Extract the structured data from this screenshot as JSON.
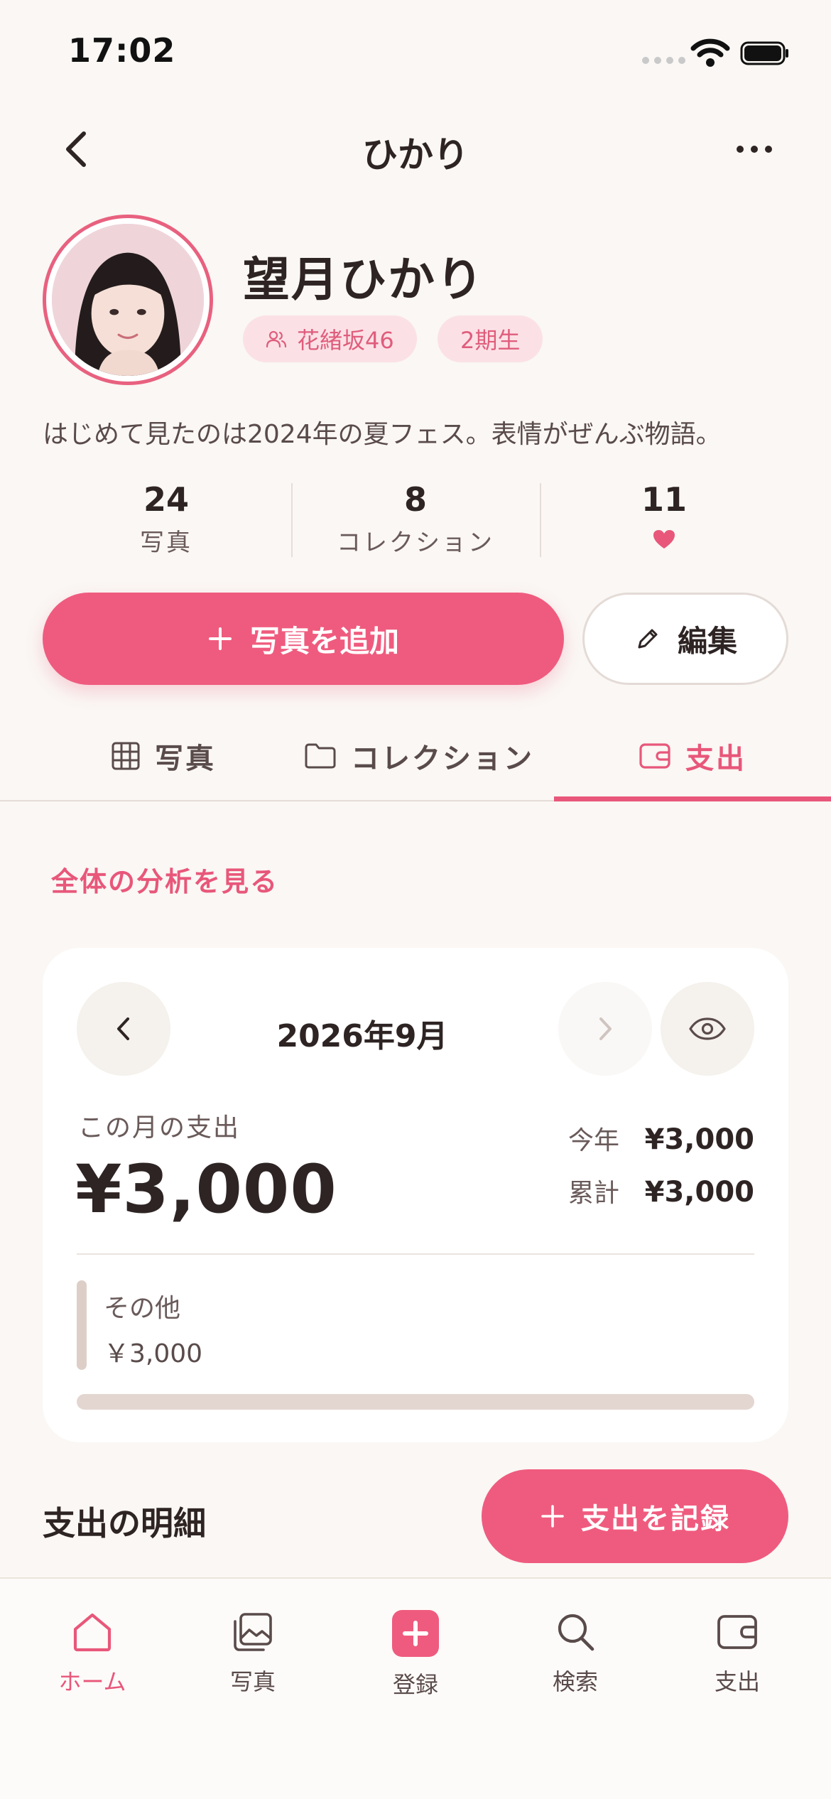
{
  "status_bar": {
    "time": "17:02"
  },
  "header": {
    "title": "ひかり"
  },
  "profile": {
    "name": "望月ひかり",
    "group_tag": "花緒坂46",
    "generation_tag": "2期生",
    "bio": "はじめて見たのは2024年の夏フェス。表情がぜんぶ物語。"
  },
  "stats": [
    {
      "value": "24",
      "label": "写真"
    },
    {
      "value": "8",
      "label": "コレクション"
    },
    {
      "value": "11",
      "label": "heart-icon"
    }
  ],
  "actions": {
    "add_photo": "写真を追加",
    "edit": "編集"
  },
  "tabs": [
    {
      "label": "写真",
      "icon": "grid-icon"
    },
    {
      "label": "コレクション",
      "icon": "folder-icon"
    },
    {
      "label": "支出",
      "icon": "wallet-icon",
      "active": true
    }
  ],
  "analysis_link": "全体の分析を見る",
  "month_card": {
    "month": "2026年9月",
    "month_label": "この月の支出",
    "month_total": "¥3,000",
    "year_label": "今年",
    "year_total": "¥3,000",
    "cumulative_label": "累計",
    "cumulative_total": "¥3,000",
    "category": {
      "name": "その他",
      "amount": "￥3,000",
      "share": 1.0
    }
  },
  "details": {
    "title": "支出の明細",
    "record_button": "支出を記録"
  },
  "bottom_nav": [
    {
      "label": "ホーム",
      "icon": "home-icon",
      "active": true
    },
    {
      "label": "写真",
      "icon": "photos-icon"
    },
    {
      "label": "登録",
      "icon": "plus-icon"
    },
    {
      "label": "検索",
      "icon": "search-icon"
    },
    {
      "label": "支出",
      "icon": "wallet-icon"
    }
  ],
  "colors": {
    "accent": "#ef5b7e",
    "background": "#faf7f4",
    "text": "#2e2424",
    "chip": "#fbe1e6"
  }
}
